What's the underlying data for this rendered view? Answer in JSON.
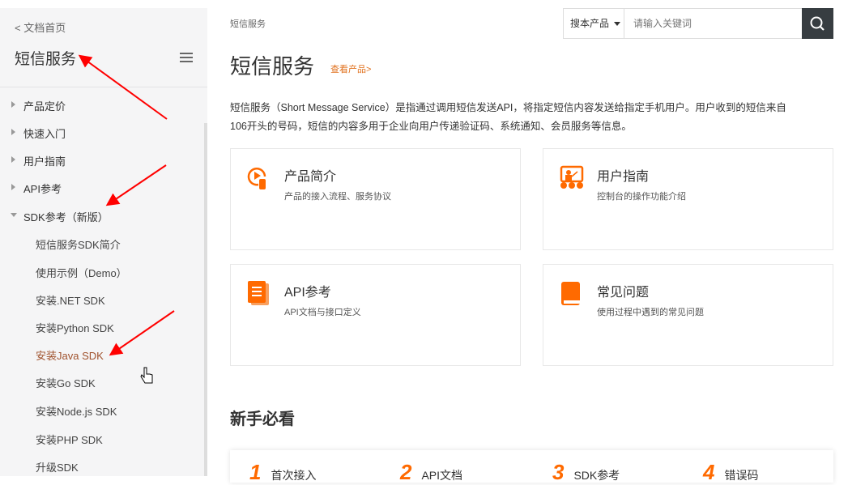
{
  "sidebar": {
    "back_link": "< 文档首页",
    "title": "短信服务",
    "items": [
      {
        "label": "产品定价",
        "expanded": false
      },
      {
        "label": "快速入门",
        "expanded": false
      },
      {
        "label": "用户指南",
        "expanded": false
      },
      {
        "label": "API参考",
        "expanded": false
      },
      {
        "label": "SDK参考（新版）",
        "expanded": true
      }
    ],
    "sub_items": [
      "短信服务SDK简介",
      "使用示例（Demo）",
      "安装.NET SDK",
      "安装Python SDK",
      "安装Java SDK",
      "安装Go SDK",
      "安装Node.js SDK",
      "安装PHP SDK",
      "升级SDK"
    ],
    "hovered_sub_item": "安装Java SDK"
  },
  "header": {
    "breadcrumb": "短信服务",
    "search_scope": "搜本产品",
    "search_placeholder": "请输入关键词"
  },
  "main": {
    "title": "短信服务",
    "view_product_link": "查看产品>",
    "description_line1": "短信服务（Short Message Service）是指通过调用短信发送API，将指定短信内容发送给指定手机用户。用户收到的短信来自",
    "description_line2": "106开头的号码，短信的内容多用于企业向用户传递验证码、系统通知、会员服务等信息。",
    "cards": [
      {
        "title": "产品简介",
        "desc": "产品的接入流程、服务协议",
        "icon": "play-touch-icon"
      },
      {
        "title": "用户指南",
        "desc": "控制台的操作功能介绍",
        "icon": "presentation-icon"
      },
      {
        "title": "API参考",
        "desc": "API文档与接口定义",
        "icon": "document-icon"
      },
      {
        "title": "常见问题",
        "desc": "使用过程中遇到的常见问题",
        "icon": "book-icon"
      }
    ],
    "section_title": "新手必看",
    "steps": [
      {
        "num": "1",
        "label": "首次接入"
      },
      {
        "num": "2",
        "label": "API文档"
      },
      {
        "num": "3",
        "label": "SDK参考"
      },
      {
        "num": "4",
        "label": "错误码"
      }
    ]
  },
  "colors": {
    "accent": "#ff6a00",
    "link_hover": "#a0522d",
    "arrow": "#ff0000",
    "search_btn": "#373d41"
  }
}
